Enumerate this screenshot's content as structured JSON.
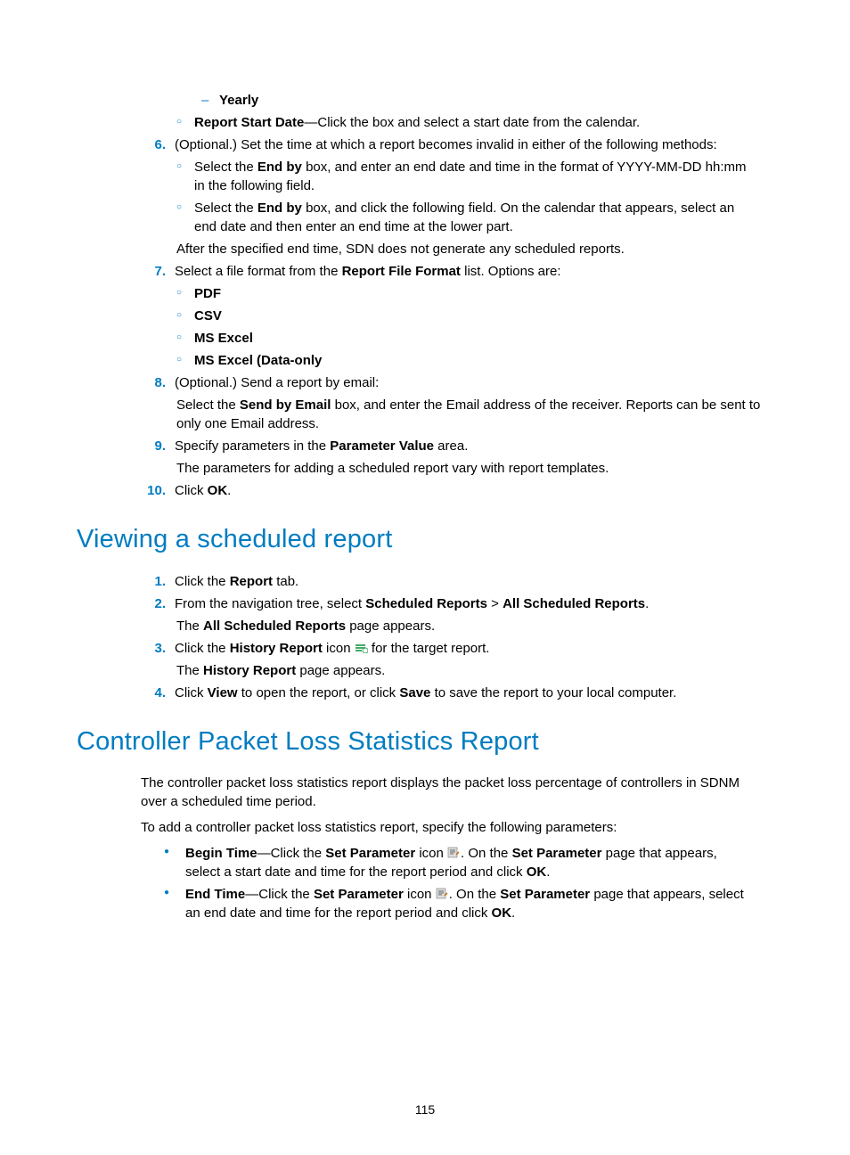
{
  "page_number": "115",
  "s5_b1": "Yearly",
  "s5_c2_pre": "Report Start Date",
  "s5_c2_post": "—Click the box and select a start date from the calendar.",
  "s6_num": "6.",
  "s6_txt": "(Optional.) Set the time at which a report becomes invalid in either of the following methods:",
  "s6_a_pre": "Select the ",
  "s6_a_b": "End by",
  "s6_a_post": " box, and enter an end date and time in the format of YYYY-MM-DD hh:mm in the following field.",
  "s6_b_pre": "Select the ",
  "s6_b_b": "End by",
  "s6_b_post": " box, and click the following field. On the calendar that appears, select an end date and then enter an end time at the lower part.",
  "s6_after": "After the specified end time, SDN does not generate any scheduled reports.",
  "s7_num": "7.",
  "s7_pre": "Select a file format from the ",
  "s7_b": "Report File Format",
  "s7_post": " list. Options are:",
  "s7_o1": "PDF",
  "s7_o2": "CSV",
  "s7_o3": "MS Excel",
  "s7_o4": "MS Excel (Data-only",
  "s8_num": "8.",
  "s8_txt": "(Optional.) Send a report by email:",
  "s8_2_pre": "Select the ",
  "s8_2_b": "Send by Email",
  "s8_2_post": " box, and enter the Email address of the receiver. Reports can be sent to only one Email address.",
  "s9_num": "9.",
  "s9_pre": "Specify parameters in the ",
  "s9_b": "Parameter Value",
  "s9_post": " area.",
  "s9_2": "The parameters for adding a scheduled report vary with report templates.",
  "s10_num": "10.",
  "s10_pre": "Click ",
  "s10_b": "OK",
  "s10_post": ".",
  "h2a": "Viewing a scheduled report",
  "v1_num": "1.",
  "v1_pre": "Click the ",
  "v1_b": "Report",
  "v1_post": " tab.",
  "v2_num": "2.",
  "v2_pre": "From the navigation tree, select ",
  "v2_b1": "Scheduled Reports",
  "v2_mid": " > ",
  "v2_b2": "All Scheduled Reports",
  "v2_post": ".",
  "v2_2_pre": "The ",
  "v2_2_b": "All Scheduled Reports",
  "v2_2_post": " page appears.",
  "v3_num": "3.",
  "v3_pre": "Click the ",
  "v3_b": "History Report",
  "v3_mid": " icon ",
  "v3_post": " for the target report.",
  "v3_2_pre": "The ",
  "v3_2_b": "History Report",
  "v3_2_post": " page appears.",
  "v4_num": "4.",
  "v4_pre": "Click ",
  "v4_b1": "View",
  "v4_mid": " to open the report, or click ",
  "v4_b2": "Save",
  "v4_post": " to save the report to your local computer.",
  "h2b": "Controller Packet Loss Statistics Report",
  "c_p1": "The controller packet loss statistics report displays the packet loss percentage of controllers in SDNM over a scheduled time period.",
  "c_p2": "To add a controller packet loss statistics report, specify the following parameters:",
  "c_b1_t1": "Begin Time",
  "c_b1_t2": "—Click the ",
  "c_b1_t3": "Set Parameter",
  "c_b1_t4": " icon ",
  "c_b1_t5": ". On the ",
  "c_b1_t6": "Set Parameter",
  "c_b1_t7": " page that appears, select a start date and time for the report period and click ",
  "c_b1_t8": "OK",
  "c_b1_t9": ".",
  "c_b2_t1": "End Time",
  "c_b2_t2": "—Click the ",
  "c_b2_t3": "Set Parameter",
  "c_b2_t4": " icon ",
  "c_b2_t5": ". On the ",
  "c_b2_t6": "Set Parameter",
  "c_b2_t7": " page that appears, select an end date and time for the report period and click ",
  "c_b2_t8": "OK",
  "c_b2_t9": "."
}
